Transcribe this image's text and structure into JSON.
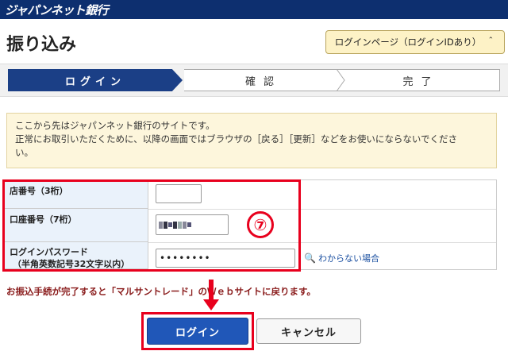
{
  "header": {
    "brand": "ジャパンネット銀行"
  },
  "page": {
    "title": "振り込み"
  },
  "login_page_button": {
    "label": "ログインページ（ログインIDあり）",
    "chevron": "＾"
  },
  "steps": [
    {
      "label": "ログイン",
      "state": "active"
    },
    {
      "label": "確認",
      "state": "pending"
    },
    {
      "label": "完了",
      "state": "pending"
    }
  ],
  "notice": {
    "lines": [
      "ここから先はジャパンネット銀行のサイトです。",
      "正常にお取引いただくために、以降の画面ではブラウザの［戻る］［更新］などをお使いにならないでくださ",
      "い。"
    ]
  },
  "form": {
    "branch_label": "店番号（3桁）",
    "branch_value": "",
    "account_label": "口座番号（7桁）",
    "password_label_1": "ログインパスワード",
    "password_label_2": "（半角英数記号32文字以内）",
    "password_value": "••••••••",
    "help_link": "わからない場合"
  },
  "annotation": {
    "number": "⑦"
  },
  "message": "お振込手続が完了すると「マルサントレード」のＷｅｂサイトに戻ります。",
  "buttons": {
    "login": "ログイン",
    "cancel": "キャンセル"
  },
  "colors": {
    "header": "#0d2f6f",
    "active_step": "#1b3f86",
    "highlight": "#e8001d",
    "login_button": "#2057b8"
  },
  "icons": [
    "chevron-up-icon",
    "question-help-icon",
    "down-arrow-icon"
  ]
}
